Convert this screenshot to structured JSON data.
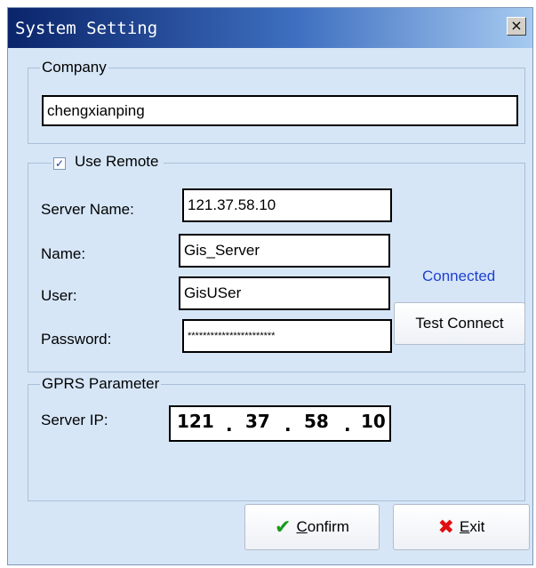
{
  "window": {
    "title": "System Setting",
    "close_label": "×"
  },
  "company": {
    "legend": "Company",
    "value": "chengxianping"
  },
  "remote": {
    "legend": "Use Remote",
    "checked": true,
    "check_mark": "✓",
    "server_name_label": "Server Name:",
    "server_name_value": "121.37.58.10",
    "name_label": "Name:",
    "name_value": "Gis_Server",
    "user_label": "User:",
    "user_value": "GisUSer",
    "password_label": "Password:",
    "password_value": "***********************",
    "status": "Connected",
    "test_button": "Test Connect"
  },
  "gprs": {
    "legend": "GPRS Parameter",
    "server_ip_label": "Server IP:",
    "ip": [
      "121",
      "37",
      "58",
      "10"
    ],
    "dot": "."
  },
  "buttons": {
    "confirm_accel": "C",
    "confirm_rest": "onfirm",
    "confirm_icon_char": "✔",
    "confirm_icon_color": "#1a9a1a",
    "exit_accel": "E",
    "exit_rest": "xit",
    "exit_icon_char": "✖",
    "exit_icon_color": "#e01010"
  }
}
